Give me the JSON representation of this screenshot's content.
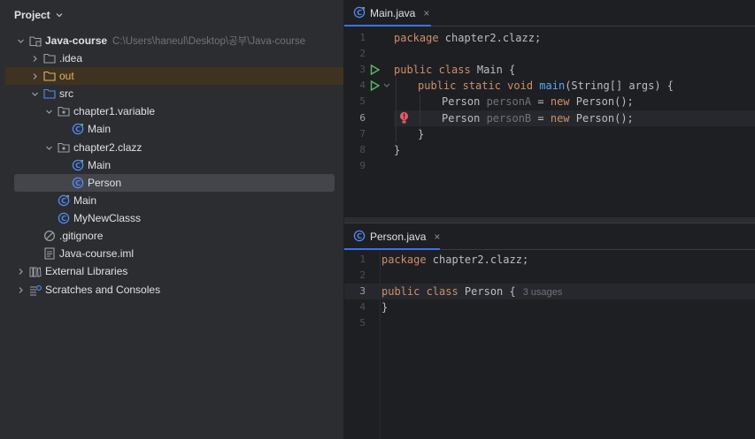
{
  "project_panel": {
    "title": "Project",
    "tree": [
      {
        "label": "Java-course",
        "path": "C:\\Users\\haneul\\Desktop\\공부\\Java-course",
        "icon": "module-folder-icon",
        "bold": true
      },
      {
        "label": ".idea",
        "icon": "folder-icon"
      },
      {
        "label": "out",
        "icon": "excluded-folder-icon"
      },
      {
        "label": "src",
        "icon": "source-folder-icon"
      },
      {
        "label": "chapter1.variable",
        "icon": "package-icon"
      },
      {
        "label": "Main",
        "icon": "java-main-class-icon"
      },
      {
        "label": "chapter2.clazz",
        "icon": "package-icon"
      },
      {
        "label": "Main",
        "icon": "java-main-class-icon"
      },
      {
        "label": "Person",
        "icon": "java-class-icon"
      },
      {
        "label": "Main",
        "icon": "java-main-class-icon"
      },
      {
        "label": "MyNewClasss",
        "icon": "java-class-icon"
      },
      {
        "label": ".gitignore",
        "icon": "ignore-file-icon"
      },
      {
        "label": "Java-course.iml",
        "icon": "iml-file-icon"
      },
      {
        "label": "External Libraries",
        "icon": "library-icon"
      },
      {
        "label": "Scratches and Consoles",
        "icon": "scratches-icon"
      }
    ]
  },
  "editor_top": {
    "tab": {
      "label": "Main.java",
      "icon": "java-main-class-icon",
      "close": "×"
    },
    "line_numbers": [
      "1",
      "2",
      "3",
      "4",
      "5",
      "6",
      "7",
      "8",
      "9"
    ],
    "code": {
      "l1_kw": "package",
      "l1_rest": " chapter2.clazz;",
      "l3_kw": "public class",
      "l3_rest": " Main {",
      "l4_kw1": "public static void",
      "l4_fn": "main",
      "l4_rest": "(String[] args) {",
      "l5_type": "Person ",
      "l5_var": "personA",
      "l5_eq": " = ",
      "l5_new": "new",
      "l5_rest": " Person();",
      "l6_type": "Person ",
      "l6_var": "personB",
      "l6_eq": " = ",
      "l6_new": "new",
      "l6_rest": " Person();",
      "l7": "}",
      "l8": "}"
    }
  },
  "editor_bottom": {
    "tab": {
      "label": "Person.java",
      "icon": "java-class-icon",
      "close": "×"
    },
    "line_numbers": [
      "1",
      "2",
      "3",
      "4",
      "5"
    ],
    "code": {
      "l1_kw": "package",
      "l1_rest": " chapter2.clazz;",
      "l3_kw": "public class",
      "l3_rest": " Person {",
      "l3_hint": "3 usages",
      "l4": "}"
    }
  },
  "colors": {
    "keyword": "#cf8e6d",
    "function": "#56a8f5",
    "unused": "#6f737a",
    "accent": "#3574f0",
    "run": "#5fb865",
    "error_bulb": "#e55765"
  }
}
